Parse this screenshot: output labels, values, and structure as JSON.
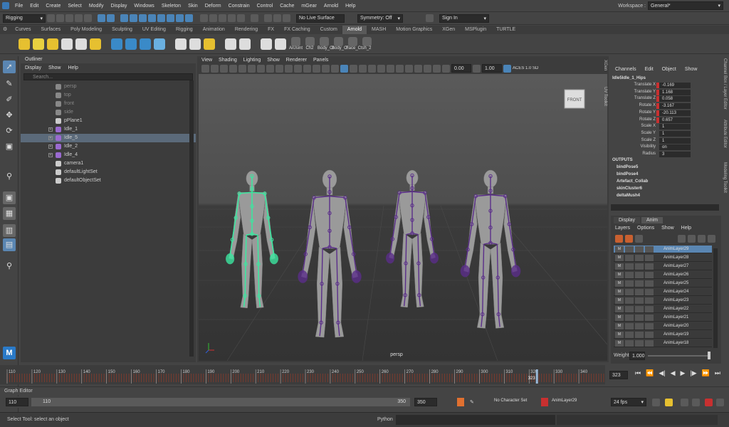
{
  "menu": [
    "File",
    "Edit",
    "Create",
    "Select",
    "Modify",
    "Display",
    "Windows",
    "Skeleton",
    "Skin",
    "Deform",
    "Constrain",
    "Control",
    "Cache",
    "mGear",
    "Arnold",
    "Help"
  ],
  "workspace": {
    "label": "Workspace :",
    "value": "General*"
  },
  "status": {
    "menuset": "Rigging",
    "live_surface": "No Live Surface",
    "symmetry": "Symmetry: Off",
    "sign_in": "Sign In"
  },
  "shelf_tabs": [
    "Curves",
    "Surfaces",
    "Poly Modeling",
    "Sculpting",
    "UV Editing",
    "Rigging",
    "Animation",
    "Rendering",
    "FX",
    "FX Caching",
    "Custom",
    "Arnold",
    "MASH",
    "Motion Graphics",
    "XGen",
    "MSPlugin",
    "TURTLE"
  ],
  "shelf_active": "Arnold",
  "shelf_labels": [
    "AiUsint",
    "Ch2",
    "Body_Ct",
    "Body_Ct",
    "Face_Ct",
    "sh_2"
  ],
  "outliner": {
    "title": "Outliner",
    "menu": [
      "Display",
      "Show",
      "Help"
    ],
    "search_placeholder": "Search...",
    "items": [
      {
        "label": "persp",
        "dim": true,
        "expand": false
      },
      {
        "label": "top",
        "dim": true,
        "expand": false
      },
      {
        "label": "front",
        "dim": true,
        "expand": false
      },
      {
        "label": "side",
        "dim": true,
        "expand": false
      },
      {
        "label": "pPlane1",
        "dim": false,
        "expand": false
      },
      {
        "label": "Idle_1",
        "dim": false,
        "expand": true
      },
      {
        "label": "Idle_5",
        "dim": false,
        "expand": true,
        "selected": true
      },
      {
        "label": "Idle_2",
        "dim": false,
        "expand": true
      },
      {
        "label": "Idle_4",
        "dim": false,
        "expand": true
      },
      {
        "label": "camera1",
        "dim": false,
        "expand": false
      },
      {
        "label": "defaultLightSet",
        "dim": false,
        "expand": false
      },
      {
        "label": "defaultObjectSet",
        "dim": false,
        "expand": false
      }
    ]
  },
  "viewport": {
    "menu": [
      "View",
      "Shading",
      "Lighting",
      "Show",
      "Renderer",
      "Panels"
    ],
    "field1": "0.00",
    "field2": "1.00",
    "colorspace": "ACES 1.0 SD",
    "camera": "persp",
    "cube": "FRONT"
  },
  "channelbox": {
    "menu": [
      "Channels",
      "Edit",
      "Object",
      "Show"
    ],
    "object": "Idle5Idle_1_Hips",
    "attrs": [
      {
        "name": "Translate X",
        "value": "-0.169",
        "keyed": true
      },
      {
        "name": "Translate Y",
        "value": "1.168",
        "keyed": true
      },
      {
        "name": "Translate Z",
        "value": "0.058",
        "keyed": true
      },
      {
        "name": "Rotate X",
        "value": "-3.167",
        "keyed": true
      },
      {
        "name": "Rotate Y",
        "value": "-20.113",
        "keyed": true
      },
      {
        "name": "Rotate Z",
        "value": "0.657",
        "keyed": true
      },
      {
        "name": "Scale X",
        "value": "1",
        "keyed": false
      },
      {
        "name": "Scale Y",
        "value": "1",
        "keyed": false
      },
      {
        "name": "Scale Z",
        "value": "1",
        "keyed": false
      },
      {
        "name": "Visibility",
        "value": "on",
        "keyed": false
      },
      {
        "name": "Radius",
        "value": "3",
        "keyed": false
      }
    ],
    "outputs_label": "OUTPUTS",
    "outputs": [
      "bindPose5",
      "bindPose4",
      "Artefact_Collab",
      "skinCluster6",
      "deltaMush4"
    ]
  },
  "side_tabs": [
    "Channel Box / Layer Editor",
    "Attribute Editor",
    "Modeling Toolkit"
  ],
  "left_side_tabs": [
    "XGen",
    "UV Toolkit"
  ],
  "layer_editor": {
    "tabs": [
      "Display",
      "Anim"
    ],
    "menu": [
      "Layers",
      "Options",
      "Show",
      "Help"
    ],
    "layers": [
      "AnimLayer29",
      "AnimLayer28",
      "AnimLayer27",
      "AnimLayer26",
      "AnimLayer25",
      "AnimLayer24",
      "AnimLayer23",
      "AnimLayer22",
      "AnimLayer21",
      "AnimLayer20",
      "AnimLayer19",
      "AnimLayer18"
    ],
    "weight_label": "Weight",
    "weight_value": "1.000"
  },
  "timeline": {
    "ticks": [
      "110",
      "120",
      "130",
      "140",
      "150",
      "160",
      "170",
      "180",
      "190",
      "200",
      "210",
      "220",
      "230",
      "240",
      "250",
      "260",
      "270",
      "280",
      "290",
      "300",
      "310",
      "320",
      "330",
      "340"
    ],
    "current": "323",
    "current_field": "323"
  },
  "graph_editor_label": "Graph Editor",
  "range": {
    "start": "110",
    "inner_start": "110",
    "inner_end": "350",
    "end": "350",
    "character": "No Character Set",
    "anim_layer": "AnimLayer29",
    "fps": "24 fps"
  },
  "command": {
    "help": "Select Tool: select an object",
    "lang": "Python"
  },
  "colors": {
    "accent": "#4a84b8",
    "selected_joint": "#3ce6a0",
    "joint": "#5a2d8a",
    "key": "#c83030"
  }
}
